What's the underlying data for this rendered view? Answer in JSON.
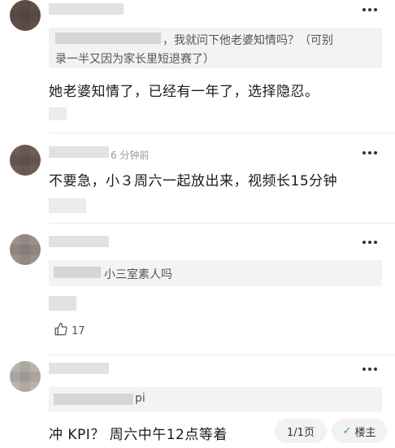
{
  "comments": [
    {
      "quote": "，我就问下他老婆知情吗？（可别",
      "quote_line2": "录一半又因为家长里短退赛了）",
      "text": "她老婆知情了，已经有一年了，选择隐忍。"
    },
    {
      "time": "6 分钟前",
      "text": "不要急，小３周六一起放出来，视频长15分钟"
    },
    {
      "quote": "小三室素人吗",
      "likes": "17"
    },
    {
      "quote": "pi",
      "text": "冲 KPI？ 周六中午12点等着"
    }
  ],
  "pager": {
    "label": "1/1页"
  },
  "op_filter": {
    "label": "楼主"
  },
  "icons": [
    "more-icon",
    "thumbs-up-icon",
    "check-icon"
  ],
  "colors": {
    "accent_green": "#39a85a",
    "quote_bg": "#f3f3f3"
  }
}
